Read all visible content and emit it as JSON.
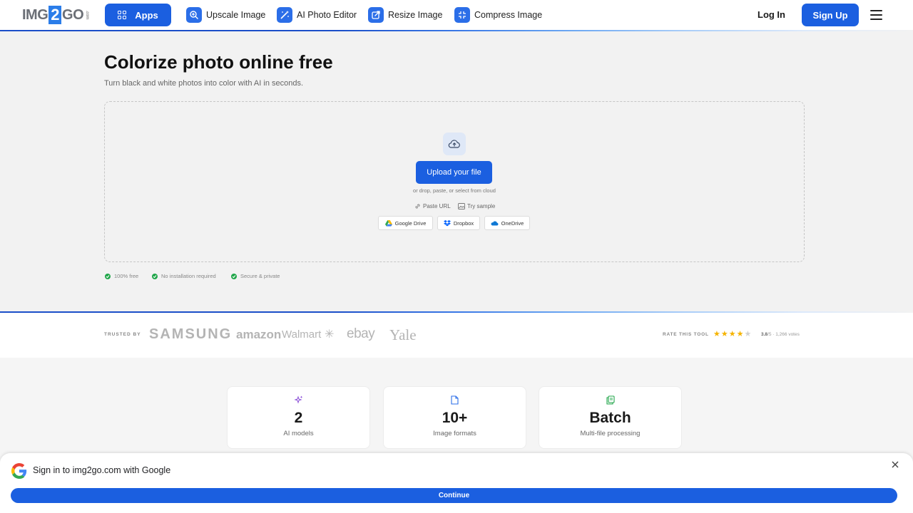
{
  "header": {
    "logo": {
      "left": "IMG",
      "mid": "2",
      "right": "GO",
      "tiny": ".com"
    },
    "apps_label": "Apps",
    "nav": [
      {
        "label": "Upscale Image",
        "icon": "upscale-icon"
      },
      {
        "label": "AI Photo Editor",
        "icon": "magic-wand-icon"
      },
      {
        "label": "Resize Image",
        "icon": "resize-icon"
      },
      {
        "label": "Compress Image",
        "icon": "compress-icon"
      }
    ],
    "login_label": "Log In",
    "signup_label": "Sign Up"
  },
  "hero": {
    "title": "Colorize photo online free",
    "subtitle": "Turn black and white photos into color with AI in seconds.",
    "upload_label": "Upload your file",
    "drop_hint": "or drop, paste, or select from cloud",
    "paste_url_label": "Paste URL",
    "try_sample_label": "Try sample",
    "cloud_sources": [
      "Google Drive",
      "Dropbox",
      "OneDrive"
    ],
    "features": [
      "100% free",
      "No installation required",
      "Secure & private"
    ]
  },
  "trust": {
    "trusted_by_label": "TRUSTED BY",
    "brands": [
      "SAMSUNG",
      "amazon",
      "Walmart",
      "ebay",
      "Yale"
    ],
    "rate_label": "RATE THIS TOOL",
    "rating_value": "3.8",
    "rating_max": "/5",
    "votes_text": " · 1,266 votes",
    "stars_filled": 4,
    "stars_total": 5
  },
  "stats": [
    {
      "value": "2",
      "label": "AI models",
      "icon": "sparkles-icon"
    },
    {
      "value": "10+",
      "label": "Image formats",
      "icon": "file-icon"
    },
    {
      "value": "Batch",
      "label": "Multi-file processing",
      "icon": "files-icon"
    }
  ],
  "google_prompt": {
    "title": "Sign in to img2go.com with Google",
    "continue_label": "Continue"
  },
  "colors": {
    "primary": "#1b5fe0",
    "success": "#21a64a",
    "star": "#f5b301"
  }
}
